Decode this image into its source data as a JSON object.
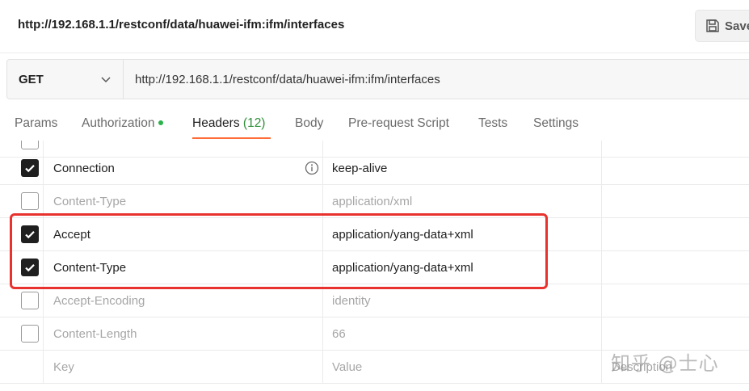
{
  "header": {
    "request_title": "http://192.168.1.1/restconf/data/huawei-ifm:ifm/interfaces",
    "save_label": "Save"
  },
  "urlbar": {
    "method": "GET",
    "url": "http://192.168.1.1/restconf/data/huawei-ifm:ifm/interfaces"
  },
  "tabs": [
    {
      "label": "Params"
    },
    {
      "label": "Authorization"
    },
    {
      "label": "Headers",
      "count": "(12)"
    },
    {
      "label": "Body"
    },
    {
      "label": "Pre-request Script"
    },
    {
      "label": "Tests"
    },
    {
      "label": "Settings"
    }
  ],
  "active_tab": "Headers",
  "headers_table": {
    "rows": [
      {
        "key": "Connection",
        "value": "keep-alive",
        "checked": true
      },
      {
        "key": "Content-Type",
        "value": "application/xml",
        "checked": false
      },
      {
        "key": "Accept",
        "value": "application/yang-data+xml",
        "checked": true
      },
      {
        "key": "Content-Type",
        "value": "application/yang-data+xml",
        "checked": true
      },
      {
        "key": "Accept-Encoding",
        "value": "identity",
        "checked": false
      },
      {
        "key": "Content-Length",
        "value": "66",
        "checked": false
      }
    ],
    "placeholder": {
      "key": "Key",
      "value": "Value",
      "description": "Description"
    }
  },
  "colors": {
    "accent_underline": "#ff6c37",
    "highlight_box": "#e8322e",
    "auth_dot": "#2bb24c",
    "header_count": "#2f8f3a"
  },
  "watermark": "知乎 @士心"
}
